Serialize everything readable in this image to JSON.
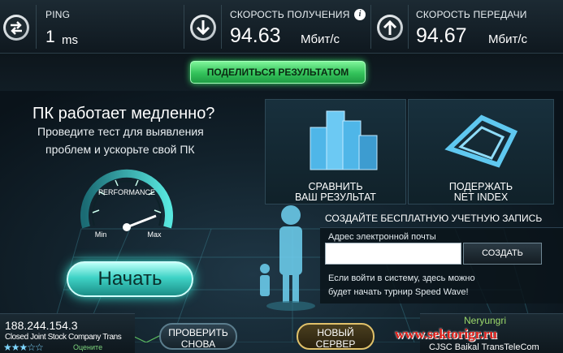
{
  "metrics": {
    "ping": {
      "label": "PING",
      "value": "1",
      "unit": "ms",
      "icon": "ping-arrows-icon"
    },
    "download": {
      "label": "СКОРОСТЬ ПОЛУЧЕНИЯ",
      "value": "94.63",
      "unit": "Мбит/с",
      "icon": "download-arrow-icon"
    },
    "upload": {
      "label": "СКОРОСТЬ ПЕРЕДАЧИ",
      "value": "94.67",
      "unit": "Мбит/с",
      "icon": "upload-arrow-icon"
    },
    "info_icon_glyph": "i"
  },
  "share": {
    "label": "ПОДЕЛИТЬСЯ РЕЗУЛЬТАТОМ",
    "color": "#33c25a"
  },
  "promo": {
    "title": "ПК работает медленно?",
    "line1": "Проведите тест для выявления",
    "line2": "проблем и ускорьте свой ПК",
    "gauge_label": "PERFORMANCE",
    "gauge_min": "Min",
    "gauge_max": "Max",
    "start_label": "Начать"
  },
  "tiles": {
    "compare": {
      "line1": "СРАВНИТЬ",
      "line2": "ВАШ РЕЗУЛЬТАТ",
      "icon": "bar-chart-icon"
    },
    "support": {
      "line1": "ПОДЕРЖАТЬ",
      "line2": "NET INDEX",
      "icon": "net-index-icon"
    }
  },
  "account": {
    "title": "СОЗДАЙТЕ БЕСПЛАТНУЮ УЧЕТНУЮ ЗАПИСЬ",
    "email_label": "Адрес электронной почты",
    "email_value": "",
    "create_label": "СОЗДАТЬ",
    "desc_line1": "Если войти в систему, здесь можно",
    "desc_line2": "будет начать турнир Speed Wave!"
  },
  "footer": {
    "ip": "188.244.154.3",
    "isp": "Closed Joint Stock Company Trans",
    "rating_stars": "★★★☆☆",
    "rate_label": "Оцените",
    "retest_line1": "ПРОВЕРИТЬ",
    "retest_line2": "СНОВА",
    "newserver_line1": "НОВЫЙ",
    "newserver_line2": "СЕРВЕР",
    "server_city": "Neryungri",
    "server_host": "CJSC Baikal TransTeleCom",
    "watermark": "www.sektorigr.ru"
  },
  "colors": {
    "accent_teal": "#36e0d0",
    "accent_green": "#33c25a",
    "accent_gold": "#e0c16a",
    "background": "#0b1218",
    "watermark_red": "#e0201a"
  }
}
